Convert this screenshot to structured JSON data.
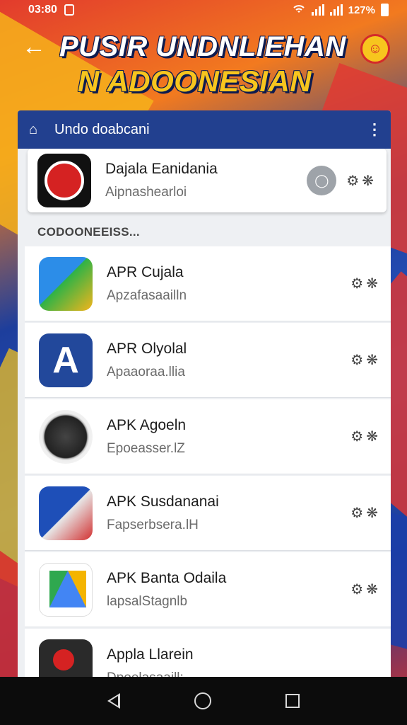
{
  "status_bar": {
    "time": "03:80",
    "battery_text": "127%"
  },
  "header": {
    "title_line1": "PUSIR UNDNLIEHAN",
    "title_line2": "N ADOONESIAN"
  },
  "panel": {
    "appbar_title": "Undo doabcani",
    "section_label": "CODOONEEISS...",
    "featured": {
      "name": "Dajala Eanidania",
      "subtitle": "Aipnashearloi"
    },
    "apps": [
      {
        "name": "APR Cujala",
        "subtitle": "Apzafasaailln",
        "icon": "app-icon-cujala"
      },
      {
        "name": "APR Olyolal",
        "subtitle": "Apaaoraa.llia",
        "icon": "app-icon-olyolal"
      },
      {
        "name": "APK Agoeln",
        "subtitle": "Epoeasser.lZ",
        "icon": "app-icon-agoeln"
      },
      {
        "name": "APK Susdananai",
        "subtitle": "Fapserbsera.lH",
        "icon": "app-icon-susdananai"
      },
      {
        "name": "APK Banta Odaila",
        "subtitle": "lapsalStagnlb",
        "icon": "app-icon-banta-odaila"
      },
      {
        "name": "Appla Llarein",
        "subtitle": "Dpoelasaaill:",
        "icon": "app-icon-appla-llarein"
      }
    ]
  }
}
